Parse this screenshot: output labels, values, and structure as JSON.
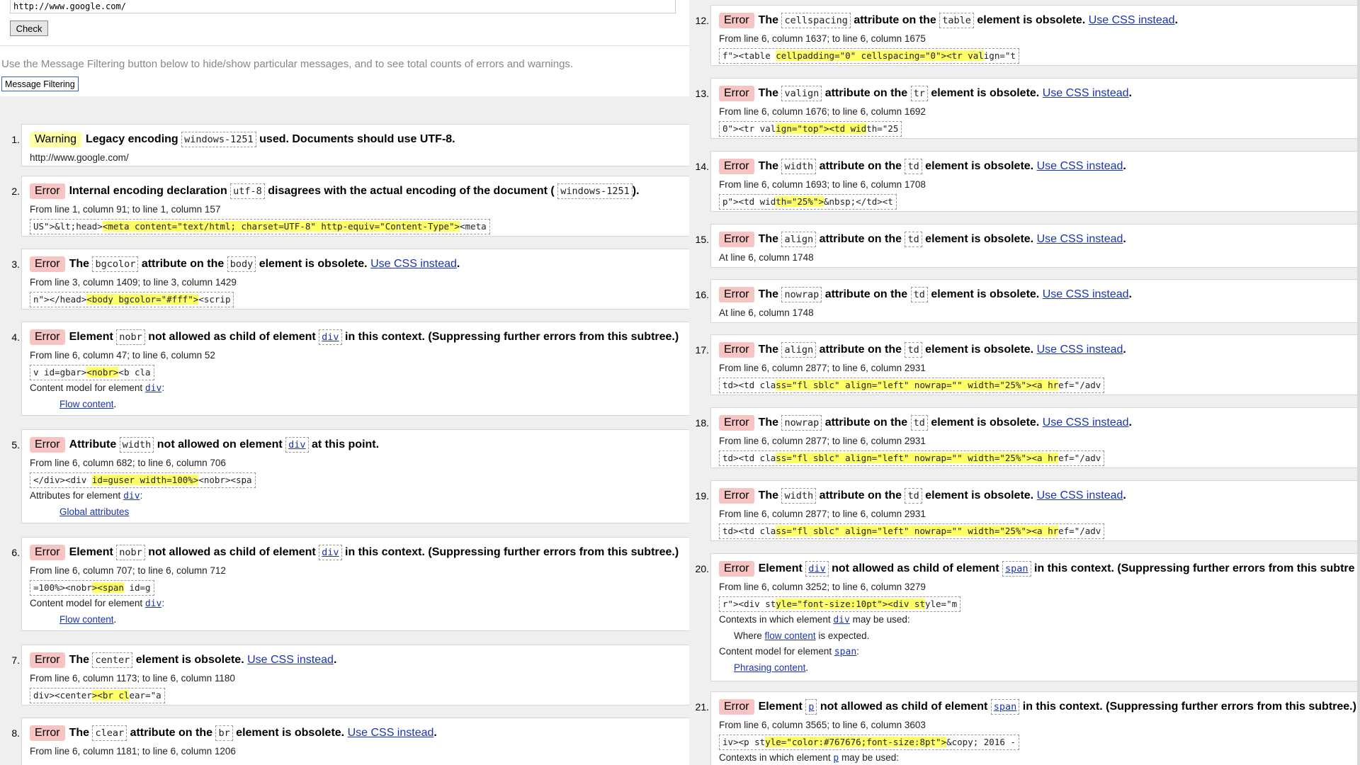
{
  "form": {
    "url": "http://www.google.com/",
    "check_label": "Check",
    "filter_note": "Use the Message Filtering button below to hide/show particular messages, and to see total counts of errors and warnings.",
    "filter_label": "Message Filtering"
  },
  "labels": {
    "error": "Error",
    "warning": "Warning",
    "use_css": "Use CSS instead"
  },
  "messages": [
    {
      "n": "1.",
      "type": "Warning",
      "pre": "Legacy encoding",
      "c1": "windows-1251",
      "mid": "used. Documents should use UTF-8.",
      "loc": "http://www.google.com/"
    },
    {
      "n": "2.",
      "type": "Error",
      "pre": "Internal encoding declaration",
      "c1": "utf-8",
      "mid": "disagrees with the actual encoding of the document (",
      "c2": "windows-1251",
      "post": ").",
      "loc": "From line 1, column 91; to line 1, column 157",
      "ext_a": "US\">&lt;head>",
      "ext_h": "<meta content=\"text/html; charset=UTF-8\" http-equiv=\"Content-Type\">",
      "ext_b": "<meta"
    },
    {
      "n": "3.",
      "type": "Error",
      "pre": "The",
      "c1": "bgcolor",
      "mid": "attribute on the",
      "c2": "body",
      "post": "element is obsolete.",
      "css": true,
      "loc": "From line 3, column 1409; to line 3, column 1429",
      "ext_a": "n\"></head>",
      "ext_h": "<body bgcolor=\"#fff\">",
      "ext_b": "<scrip"
    },
    {
      "n": "4.",
      "type": "Error",
      "pre": "Element",
      "c1": "nobr",
      "mid": "not allowed as child of element",
      "c2": "div",
      "c2link": true,
      "post": "in this context. (Suppressing further errors from this subtree.)",
      "loc": "From line 6, column 47; to line 6, column 52",
      "ext_a": "v id=gbar>",
      "ext_h": "<nobr>",
      "ext_b": "<b cla",
      "extra_label": "Content model for element",
      "extra_code": "div",
      "extra_sub": "Flow content"
    },
    {
      "n": "5.",
      "type": "Error",
      "pre": "Attribute",
      "c1": "width",
      "mid": "not allowed on element",
      "c2": "div",
      "c2link": true,
      "post": "at this point.",
      "loc": "From line 6, column 682; to line 6, column 706",
      "ext_a": "</div><div ",
      "ext_h": "id=guser width=100%>",
      "ext_b": "<nobr><spa",
      "extra_label": "Attributes for element",
      "extra_code": "div",
      "extra_sub": "Global attributes"
    },
    {
      "n": "6.",
      "type": "Error",
      "pre": "Element",
      "c1": "nobr",
      "mid": "not allowed as child of element",
      "c2": "div",
      "c2link": true,
      "post": "in this context. (Suppressing further errors from this subtree.)",
      "loc": "From line 6, column 707; to line 6, column 712",
      "ext_a": "=100%><nobr",
      "ext_h": "><span",
      "ext_b": " id=g",
      "extra_label": "Content model for element",
      "extra_code": "div",
      "extra_sub": "Flow content"
    },
    {
      "n": "7.",
      "type": "Error",
      "pre": "The",
      "c1": "center",
      "mid": "element is obsolete.",
      "css": true,
      "loc": "From line 6, column 1173; to line 6, column 1180",
      "ext_a": "div><center",
      "ext_h": "><br cl",
      "ext_b": "ear=\"a"
    },
    {
      "n": "8.",
      "type": "Error",
      "pre": "The",
      "c1": "clear",
      "mid": "attribute on the",
      "c2": "br",
      "post": "element is obsolete.",
      "css": true,
      "loc": "From line 6, column 1181; to line 6, column 1206"
    },
    {
      "n": "12.",
      "type": "Error",
      "pre": "The",
      "c1": "cellspacing",
      "mid": "attribute on the",
      "c2": "table",
      "post": "element is obsolete.",
      "css": true,
      "loc": "From line 6, column 1637; to line 6, column 1675",
      "ext_a": "f\"><table ",
      "ext_h": "cellpadding=\"0\" cellspacing=\"0\"><tr val",
      "ext_b": "ign=\"t"
    },
    {
      "n": "13.",
      "type": "Error",
      "pre": "The",
      "c1": "valign",
      "mid": "attribute on the",
      "c2": "tr",
      "post": "element is obsolete.",
      "css": true,
      "loc": "From line 6, column 1676; to line 6, column 1692",
      "ext_a": "0\"><tr val",
      "ext_h": "ign=\"top\"><td wid",
      "ext_b": "th=\"25"
    },
    {
      "n": "14.",
      "type": "Error",
      "pre": "The",
      "c1": "width",
      "mid": "attribute on the",
      "c2": "td",
      "post": "element is obsolete.",
      "css": true,
      "loc": "From line 6, column 1693; to line 6, column 1708",
      "ext_a": "p\"><td wid",
      "ext_h": "th=\"25%\">",
      "ext_b": "&nbsp;</td><t"
    },
    {
      "n": "15.",
      "type": "Error",
      "pre": "The",
      "c1": "align",
      "mid": "attribute on the",
      "c2": "td",
      "post": "element is obsolete.",
      "css": true,
      "loc": "At line 6, column 1748"
    },
    {
      "n": "16.",
      "type": "Error",
      "pre": "The",
      "c1": "nowrap",
      "mid": "attribute on the",
      "c2": "td",
      "post": "element is obsolete.",
      "css": true,
      "loc": "At line 6, column 1748"
    },
    {
      "n": "17.",
      "type": "Error",
      "pre": "The",
      "c1": "align",
      "mid": "attribute on the",
      "c2": "td",
      "post": "element is obsolete.",
      "css": true,
      "loc": "From line 6, column 2877; to line 6, column 2931",
      "ext_a": "td><td cla",
      "ext_h": "ss=\"fl sblc\" align=\"left\" nowrap=\"\" width=\"25%\"><a hr",
      "ext_b": "ef=\"/adv"
    },
    {
      "n": "18.",
      "type": "Error",
      "pre": "The",
      "c1": "nowrap",
      "mid": "attribute on the",
      "c2": "td",
      "post": "element is obsolete.",
      "css": true,
      "loc": "From line 6, column 2877; to line 6, column 2931",
      "ext_a": "td><td cla",
      "ext_h": "ss=\"fl sblc\" align=\"left\" nowrap=\"\" width=\"25%\"><a hr",
      "ext_b": "ef=\"/adv"
    },
    {
      "n": "19.",
      "type": "Error",
      "pre": "The",
      "c1": "width",
      "mid": "attribute on the",
      "c2": "td",
      "post": "element is obsolete.",
      "css": true,
      "loc": "From line 6, column 2877; to line 6, column 2931",
      "ext_a": "td><td cla",
      "ext_h": "ss=\"fl sblc\" align=\"left\" nowrap=\"\" width=\"25%\"><a hr",
      "ext_b": "ef=\"/adv"
    },
    {
      "n": "20.",
      "type": "Error",
      "pre": "Element",
      "c1": "div",
      "c1link": true,
      "mid": "not allowed as child of element",
      "c2": "span",
      "c2link": true,
      "post": "in this context. (Suppressing further errors from this subtre",
      "loc": "From line 6, column 3252; to line 6, column 3279",
      "ext_a": "r\"><div st",
      "ext_h": "yle=\"font-size:10pt\"><div st",
      "ext_b": "yle=\"m",
      "extra_label": "Contexts in which element",
      "extra_code": "div",
      "extra_tail": "may be used:",
      "extra_where_pre": "Where",
      "extra_where_link": "flow content",
      "extra_where_post": "is expected.",
      "extra2_label": "Content model for element",
      "extra2_code": "span",
      "extra2_sub": "Phrasing content"
    },
    {
      "n": "21.",
      "type": "Error",
      "pre": "Element",
      "c1": "p",
      "c1link": true,
      "mid": "not allowed as child of element",
      "c2": "span",
      "c2link": true,
      "post": "in this context. (Suppressing further errors from this subtree.)",
      "loc": "From line 6, column 3565; to line 6, column 3603",
      "ext_a": "iv><p st",
      "ext_h": "yle=\"color:#767676;font-size:8pt\">",
      "ext_b": "&copy; 2016 -",
      "extra_label": "Contexts in which element",
      "extra_code": "p",
      "extra_tail": "may be used:"
    }
  ]
}
